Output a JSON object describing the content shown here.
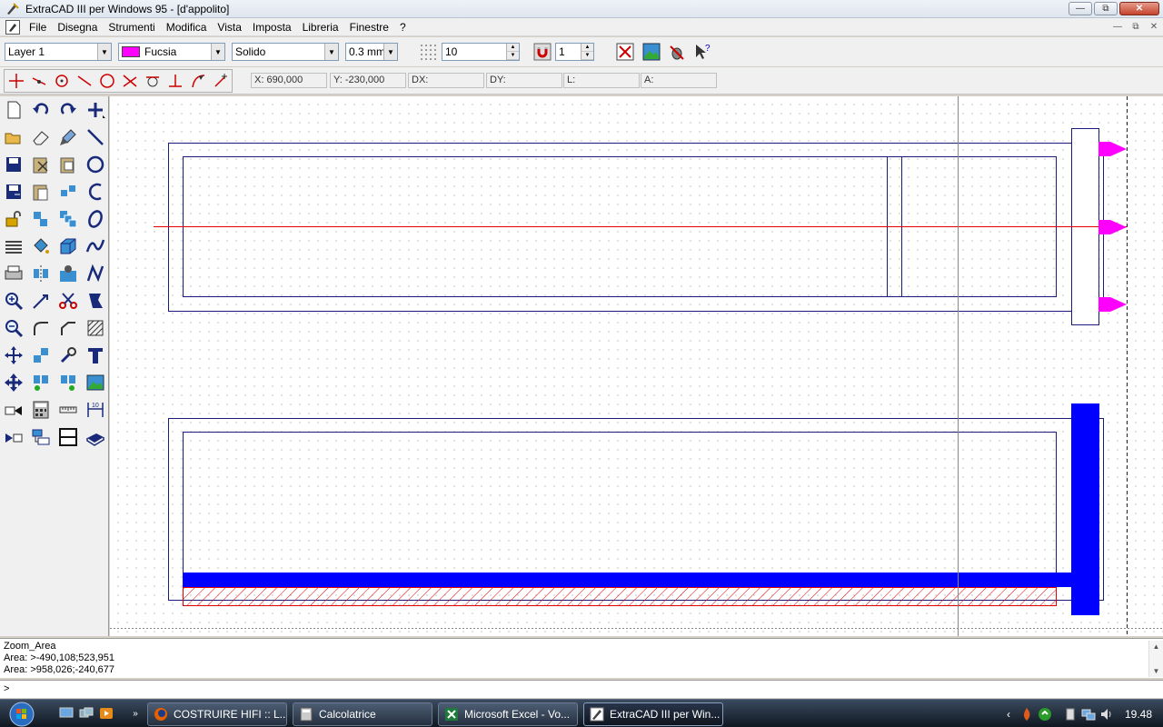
{
  "window": {
    "title": "ExtraCAD III per Windows 95 - [d'appolito]"
  },
  "menu": [
    "File",
    "Disegna",
    "Strumenti",
    "Modifica",
    "Vista",
    "Imposta",
    "Libreria",
    "Finestre",
    "?"
  ],
  "toolbar": {
    "layer": "Layer  1",
    "color_name": "Fucsia",
    "color_hex": "#ff00ff",
    "linetype": "Solido",
    "linewidth": "0.3 mm",
    "grid_value": "10",
    "snap_value": "1"
  },
  "status": {
    "x": "X: 690,000",
    "y": "Y: -230,000",
    "dx": "DX:",
    "dy": "DY:",
    "l": "L:",
    "a": "A:"
  },
  "command": {
    "lines": [
      "Zoom_Area",
      "Area: >-490,108;523,951",
      "Area: >958,026;-240,677"
    ],
    "prompt": ">"
  },
  "taskbar": {
    "items": [
      {
        "label": "COSTRUIRE HIFI :: L...",
        "icon": "firefox-icon"
      },
      {
        "label": "Calcolatrice",
        "icon": "calculator-icon"
      },
      {
        "label": "Microsoft Excel - Vo...",
        "icon": "excel-icon"
      },
      {
        "label": "ExtraCAD III per Win...",
        "icon": "extracad-icon"
      }
    ],
    "clock": "19.48"
  },
  "colors": {
    "accent_blue": "#0000ff",
    "axis_red": "#ff0000",
    "fuchsia": "#ff00ff"
  }
}
